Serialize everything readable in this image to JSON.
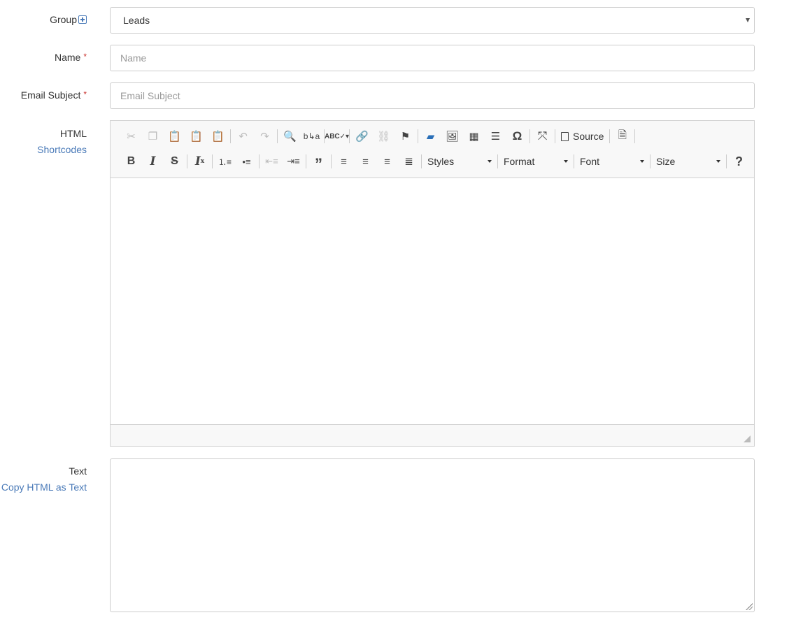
{
  "group": {
    "label": "Group",
    "value": "Leads"
  },
  "name": {
    "label": "Name",
    "required_mark": "*",
    "placeholder": "Name"
  },
  "subject": {
    "label": "Email Subject",
    "required_mark": "*",
    "placeholder": "Email Subject"
  },
  "html": {
    "label": "HTML",
    "link": "Shortcodes"
  },
  "toolbar": {
    "source_label": "Source",
    "styles_label": "Styles",
    "format_label": "Format",
    "font_label": "Font",
    "size_label": "Size",
    "help_label": "?"
  },
  "text": {
    "label": "Text",
    "link": "Copy HTML as Text"
  }
}
